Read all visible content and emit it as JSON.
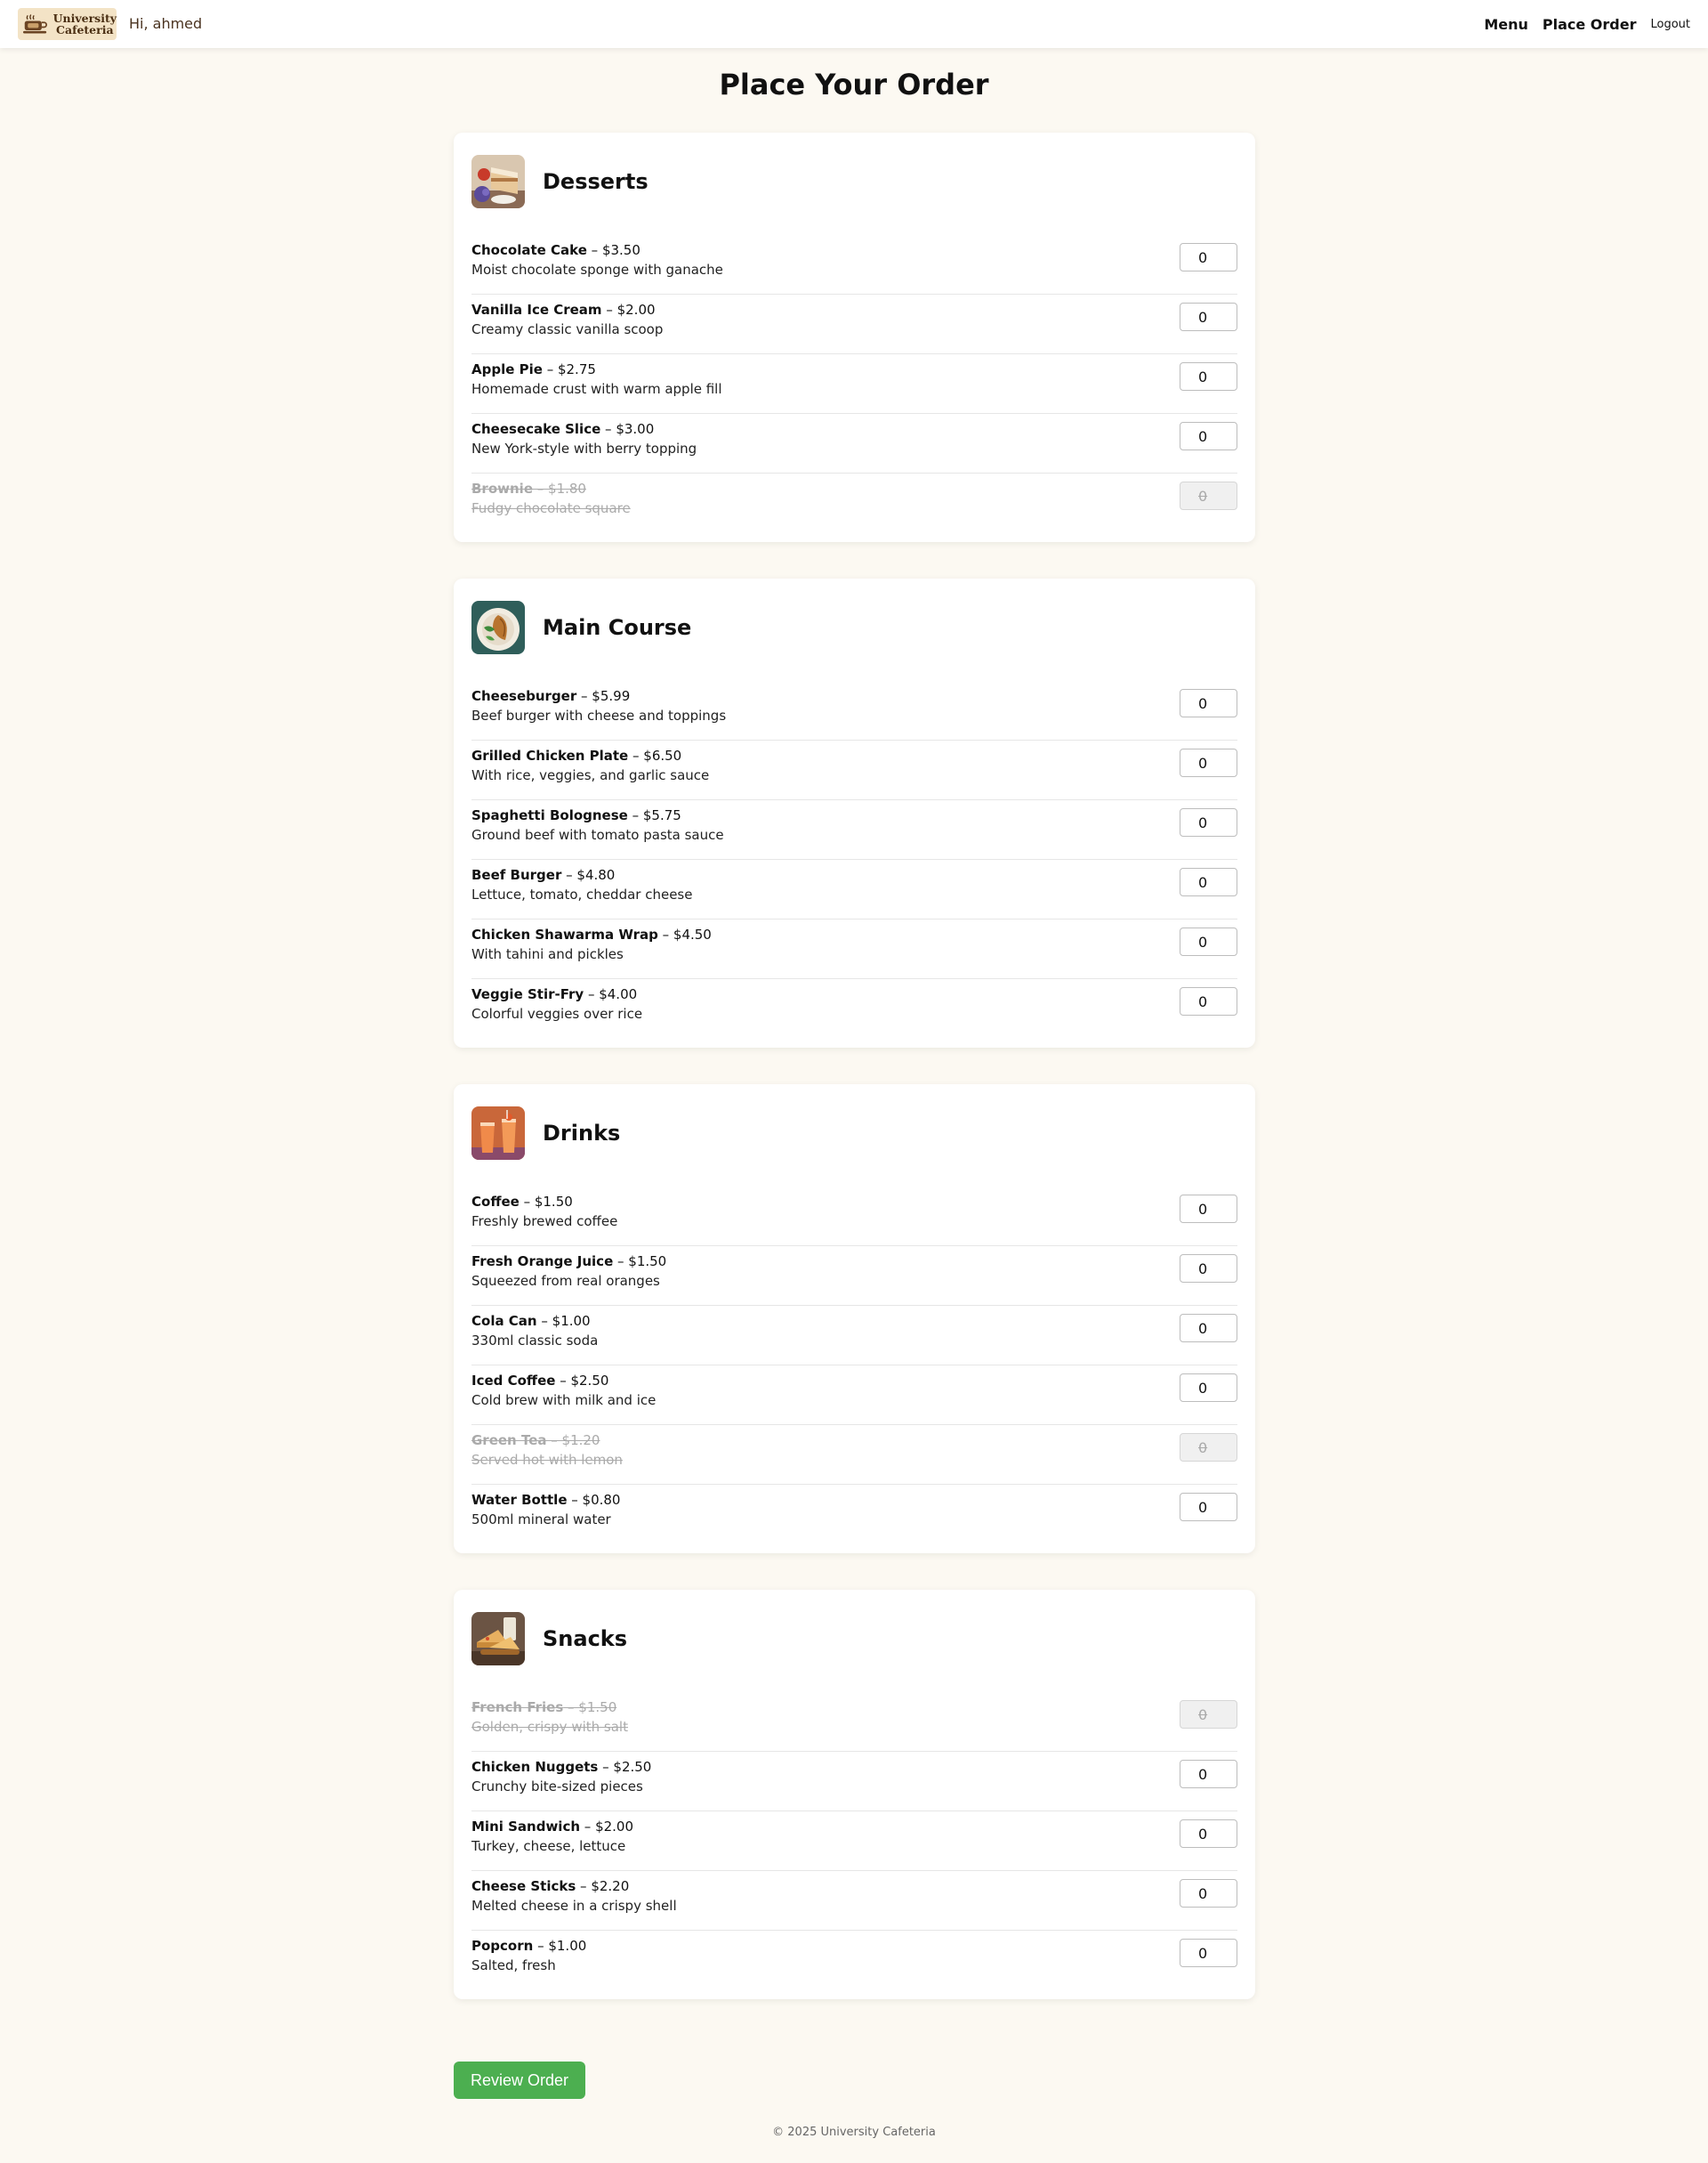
{
  "navbar": {
    "logo_line1": "University",
    "logo_line2": "Cafeteria",
    "greeting": "Hi, ahmed",
    "links": {
      "menu": "Menu",
      "place_order": "Place Order",
      "logout": "Logout"
    }
  },
  "page": {
    "title": "Place Your Order"
  },
  "categories": [
    {
      "title": "Desserts",
      "image_icon": "desserts-image",
      "items": [
        {
          "name": "Chocolate Cake",
          "price": " – $3.50",
          "desc": "Moist chocolate sponge with ganache",
          "qty": "0",
          "available": true
        },
        {
          "name": "Vanilla Ice Cream",
          "price": " – $2.00",
          "desc": "Creamy classic vanilla scoop",
          "qty": "0",
          "available": true
        },
        {
          "name": "Apple Pie",
          "price": " – $2.75",
          "desc": "Homemade crust with warm apple fill",
          "qty": "0",
          "available": true
        },
        {
          "name": "Cheesecake Slice",
          "price": " – $3.00",
          "desc": "New York-style with berry topping",
          "qty": "0",
          "available": true
        },
        {
          "name": "Brownie",
          "price": " – $1.80",
          "desc": "Fudgy chocolate square",
          "qty": "0",
          "available": false
        }
      ]
    },
    {
      "title": "Main Course",
      "image_icon": "main-course-image",
      "items": [
        {
          "name": "Cheeseburger",
          "price": " – $5.99",
          "desc": "Beef burger with cheese and toppings",
          "qty": "0",
          "available": true
        },
        {
          "name": "Grilled Chicken Plate",
          "price": " – $6.50",
          "desc": "With rice, veggies, and garlic sauce",
          "qty": "0",
          "available": true
        },
        {
          "name": "Spaghetti Bolognese",
          "price": " – $5.75",
          "desc": "Ground beef with tomato pasta sauce",
          "qty": "0",
          "available": true
        },
        {
          "name": "Beef Burger",
          "price": " – $4.80",
          "desc": "Lettuce, tomato, cheddar cheese",
          "qty": "0",
          "available": true
        },
        {
          "name": "Chicken Shawarma Wrap",
          "price": " – $4.50",
          "desc": "With tahini and pickles",
          "qty": "0",
          "available": true
        },
        {
          "name": "Veggie Stir-Fry",
          "price": " – $4.00",
          "desc": "Colorful veggies over rice",
          "qty": "0",
          "available": true
        }
      ]
    },
    {
      "title": "Drinks",
      "image_icon": "drinks-image",
      "items": [
        {
          "name": "Coffee",
          "price": " – $1.50",
          "desc": "Freshly brewed coffee",
          "qty": "0",
          "available": true
        },
        {
          "name": "Fresh Orange Juice",
          "price": " – $1.50",
          "desc": "Squeezed from real oranges",
          "qty": "0",
          "available": true
        },
        {
          "name": "Cola Can",
          "price": " – $1.00",
          "desc": "330ml classic soda",
          "qty": "0",
          "available": true
        },
        {
          "name": "Iced Coffee",
          "price": " – $2.50",
          "desc": "Cold brew with milk and ice",
          "qty": "0",
          "available": true
        },
        {
          "name": "Green Tea",
          "price": " – $1.20",
          "desc": "Served hot with lemon",
          "qty": "0",
          "available": false
        },
        {
          "name": "Water Bottle",
          "price": " – $0.80",
          "desc": "500ml mineral water",
          "qty": "0",
          "available": true
        }
      ]
    },
    {
      "title": "Snacks",
      "image_icon": "snacks-image",
      "items": [
        {
          "name": "French Fries",
          "price": " – $1.50",
          "desc": "Golden, crispy with salt",
          "qty": "0",
          "available": false
        },
        {
          "name": "Chicken Nuggets",
          "price": " – $2.50",
          "desc": "Crunchy bite-sized pieces",
          "qty": "0",
          "available": true
        },
        {
          "name": "Mini Sandwich",
          "price": " – $2.00",
          "desc": "Turkey, cheese, lettuce",
          "qty": "0",
          "available": true
        },
        {
          "name": "Cheese Sticks",
          "price": " – $2.20",
          "desc": "Melted cheese in a crispy shell",
          "qty": "0",
          "available": true
        },
        {
          "name": "Popcorn",
          "price": " – $1.00",
          "desc": "Salted, fresh",
          "qty": "0",
          "available": true
        }
      ]
    }
  ],
  "actions": {
    "review_label": "Review Order"
  },
  "footer": {
    "text": "© 2025 University Cafeteria"
  },
  "colors": {
    "accent": "#4caf50",
    "background": "#fcf9f2",
    "logo_bg": "#f3e3c6"
  }
}
